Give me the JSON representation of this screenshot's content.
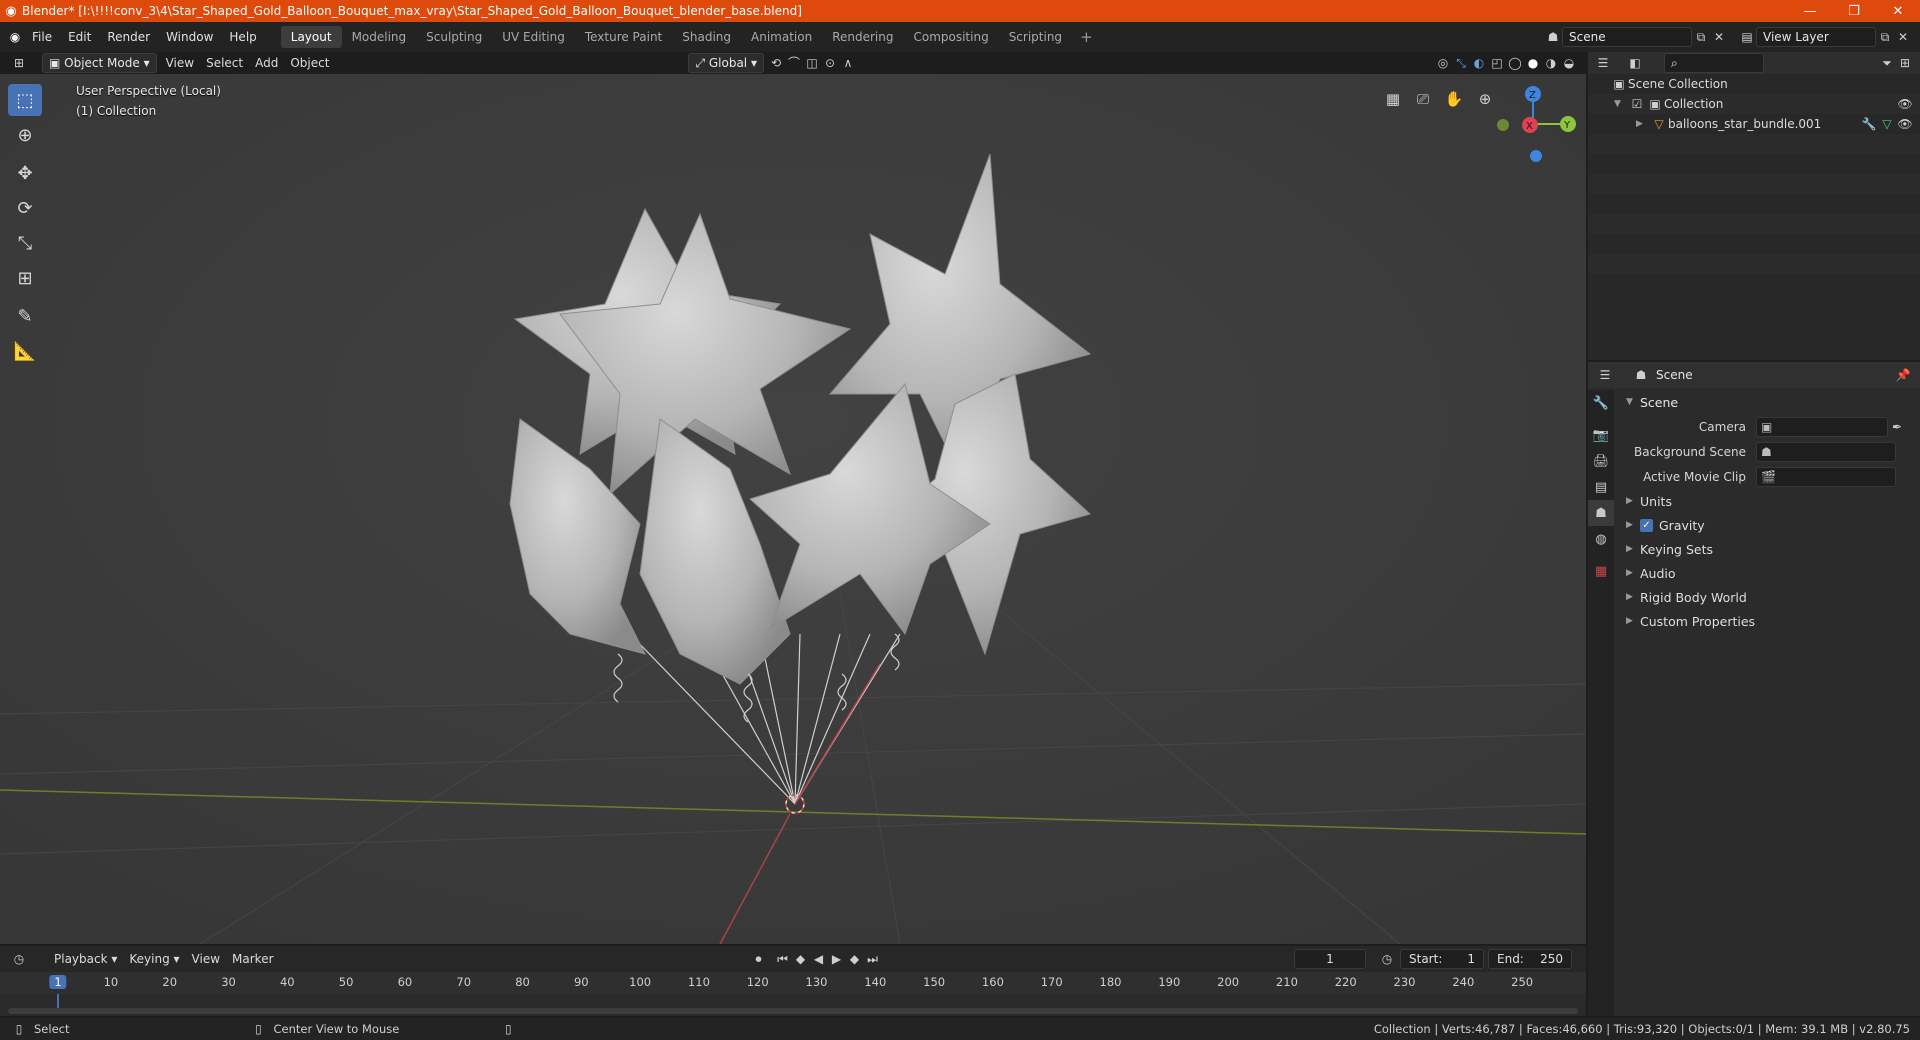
{
  "window": {
    "title": "Blender* [I:\\!!!!conv_3\\4\\Star_Shaped_Gold_Balloon_Bouquet_max_vray\\Star_Shaped_Gold_Balloon_Bouquet_blender_base.blend]",
    "controls": {
      "minimize": "—",
      "restore": "❐",
      "close": "✕"
    }
  },
  "menu": {
    "items": [
      "File",
      "Edit",
      "Render",
      "Window",
      "Help"
    ]
  },
  "workspaces": {
    "tabs": [
      "Layout",
      "Modeling",
      "Sculpting",
      "UV Editing",
      "Texture Paint",
      "Shading",
      "Animation",
      "Rendering",
      "Compositing",
      "Scripting"
    ],
    "active": "Layout",
    "add": "+"
  },
  "scene_selector": {
    "value": "Scene"
  },
  "view_layer_selector": {
    "value": "View Layer"
  },
  "viewport_header": {
    "mode": "Object Mode",
    "menus": [
      "View",
      "Select",
      "Add",
      "Object"
    ],
    "orientation": "Global"
  },
  "viewport": {
    "perspective_label": "User Perspective (Local)",
    "collection_label": "(1) Collection",
    "gizmo": {
      "x": "X",
      "y": "Y",
      "z": "Z"
    }
  },
  "outliner": {
    "rows": [
      {
        "label": "Scene Collection"
      },
      {
        "label": "Collection"
      },
      {
        "label": "balloons_star_bundle.001"
      }
    ]
  },
  "properties": {
    "header": "Scene",
    "panel": "Scene",
    "fields": [
      {
        "label": "Camera"
      },
      {
        "label": "Background Scene"
      },
      {
        "label": "Active Movie Clip"
      }
    ],
    "subpanels": [
      "Units",
      "Gravity",
      "Keying Sets",
      "Audio",
      "Rigid Body World",
      "Custom Properties"
    ]
  },
  "timeline": {
    "menus": [
      "Playback",
      "Keying",
      "View",
      "Marker"
    ],
    "current_frame": "1",
    "start_label": "Start:",
    "start": "1",
    "end_label": "End:",
    "end": "250",
    "ruler": [
      "1",
      "10",
      "20",
      "30",
      "40",
      "50",
      "60",
      "70",
      "80",
      "90",
      "100",
      "110",
      "120",
      "130",
      "140",
      "150",
      "160",
      "170",
      "180",
      "190",
      "200",
      "210",
      "220",
      "230",
      "240",
      "250"
    ]
  },
  "statusbar": {
    "select": "Select",
    "center_view": "Center View to Mouse",
    "info": "Collection | Verts:46,787 | Faces:46,660 | Tris:93,320 | Objects:0/1 | Mem: 39.1 MB | v2.80.75"
  },
  "colors": {
    "titlebar": "#dd4a0c",
    "accent": "#4772b3",
    "viewport_bg": "#3c3c3c",
    "x_axis": "#e0414f",
    "y_axis": "#8cc63f",
    "z_axis": "#3f84e0"
  }
}
